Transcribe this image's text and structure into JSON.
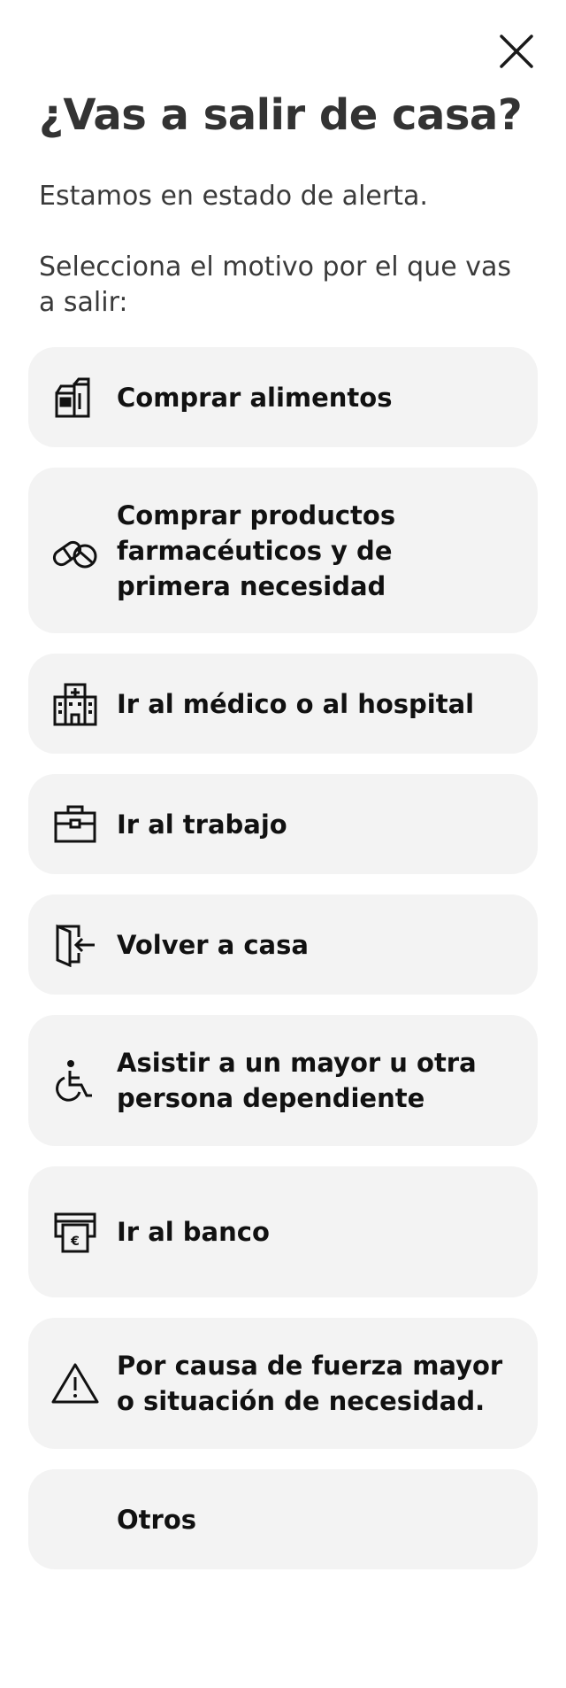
{
  "header": {
    "close_icon": "close-icon"
  },
  "title": "¿Vas a salir de casa?",
  "intro": {
    "line1": "Estamos en estado de alerta.",
    "line2": "Selecciona el motivo por el que vas a salir:"
  },
  "options": [
    {
      "label": "Comprar alimentos",
      "icon": "groceries-icon"
    },
    {
      "label": "Comprar productos farmacéuticos y de primera necesidad",
      "icon": "pills-icon"
    },
    {
      "label": "Ir al médico o al hospital",
      "icon": "hospital-icon"
    },
    {
      "label": "Ir al trabajo",
      "icon": "briefcase-icon"
    },
    {
      "label": "Volver a casa",
      "icon": "door-enter-icon"
    },
    {
      "label": "Asistir a un mayor u otra persona dependiente",
      "icon": "wheelchair-icon"
    },
    {
      "label": "Ir al banco",
      "icon": "atm-euro-icon"
    },
    {
      "label": "Por causa de fuerza mayor o situación de necesidad.",
      "icon": "warning-icon"
    },
    {
      "label": "Otros",
      "icon": ""
    }
  ],
  "colors": {
    "card_background": "#f3f3f3",
    "text": "#111111",
    "title": "#333333"
  }
}
